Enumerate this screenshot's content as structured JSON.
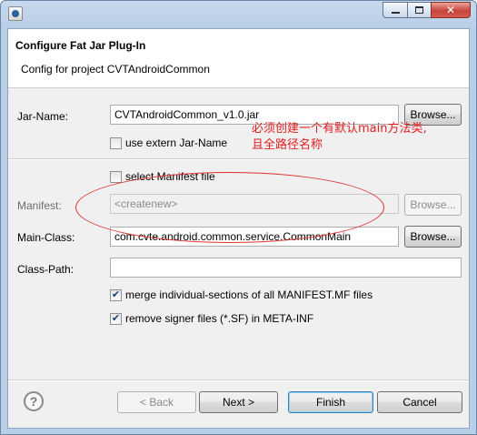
{
  "window": {
    "minimize_glyph": "",
    "maximize_glyph": "",
    "close_glyph": "✕"
  },
  "header": {
    "title": "Configure Fat Jar Plug-In",
    "message": "Config for project CVTAndroidCommon"
  },
  "form": {
    "jar_name_label": "Jar-Name:",
    "jar_name_value": "CVTAndroidCommon_v1.0.jar",
    "jar_browse": "Browse...",
    "use_extern_label": "use extern Jar-Name",
    "use_extern_checked": false,
    "select_manifest_label": "select Manifest file",
    "select_manifest_checked": false,
    "manifest_label": "Manifest:",
    "manifest_value": "<createnew>",
    "manifest_browse": "Browse...",
    "main_class_label": "Main-Class:",
    "main_class_value": "com.cvte.android.common.service.CommonMain",
    "main_class_browse": "Browse...",
    "class_path_label": "Class-Path:",
    "class_path_value": "",
    "merge_label": "merge individual-sections of all MANIFEST.MF files",
    "merge_checked": true,
    "remove_signer_label": "remove signer files (*.SF) in META-INF",
    "remove_signer_checked": true
  },
  "annotation": {
    "line1": "必须创建一个有默认main方法类,",
    "line2": "且全路径名称"
  },
  "footer": {
    "help_glyph": "?",
    "back": "< Back",
    "next": "Next >",
    "finish": "Finish",
    "cancel": "Cancel"
  }
}
